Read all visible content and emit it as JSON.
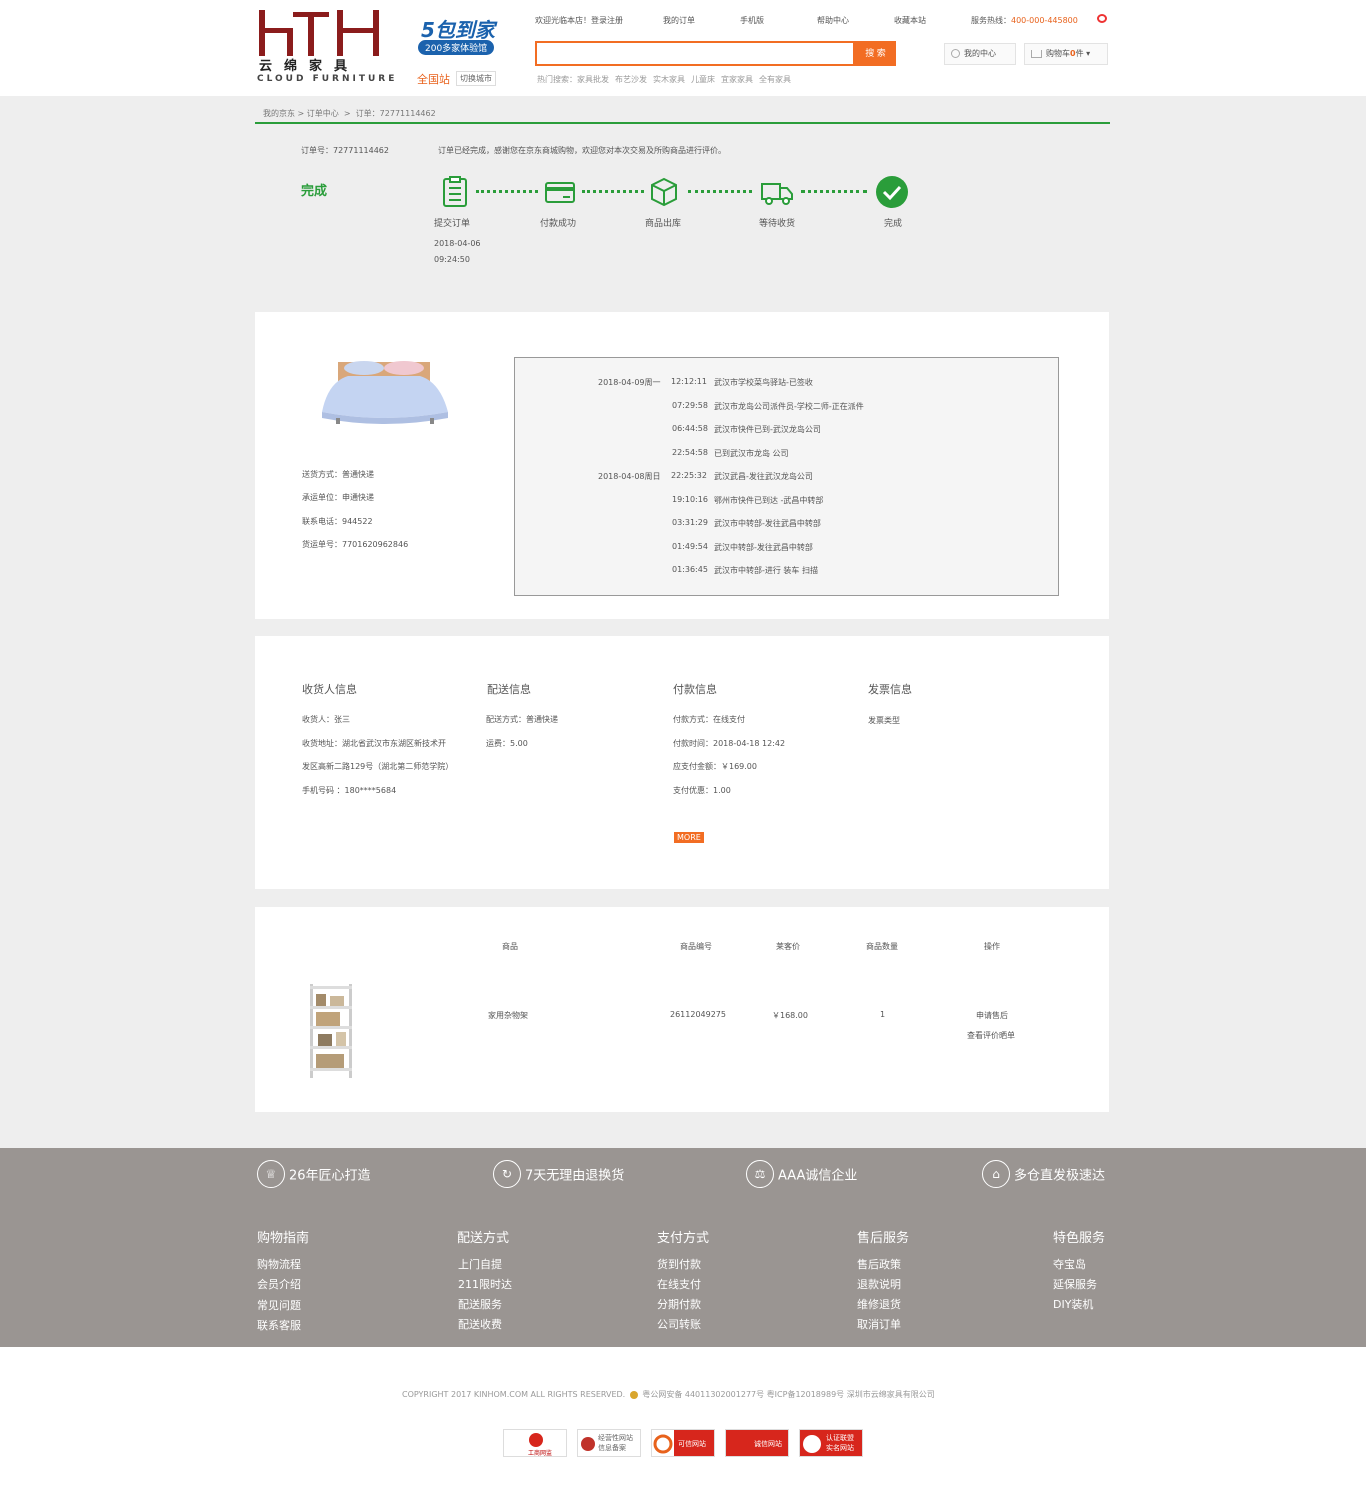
{
  "header": {
    "brand_cn": "云绵家具",
    "brand_en": "CLOUD FURNITURE",
    "promo_big": "5包到家",
    "promo_small": "200多家体验馆",
    "site_all": "全国站",
    "switch_city": "切换城市",
    "welcome": "欢迎光临本店！登录注册",
    "my_orders": "我的订单",
    "mobile": "手机版",
    "help": "帮助中心",
    "favorite": "收藏本站",
    "hotline_label": "服务热线：",
    "hotline": "400-000-445800",
    "search_button": "搜 索",
    "hot_search_label": "热门搜索：",
    "hot_search": [
      "家具批发",
      "布艺沙发",
      "实木家具",
      "儿童床",
      "宜家家具",
      "全有家具"
    ],
    "my_center": "我的中心",
    "cart_label": "购物车",
    "cart_count": "0",
    "cart_unit": "件"
  },
  "breadcrumb": {
    "home": "我的京东",
    "sep1": ">",
    "orders": "订单中心",
    "sep2": ">",
    "current": "订单：72771114462"
  },
  "order": {
    "number": "订单号：72771114462",
    "message": "订单已经完成，感谢您在京东商城购物，欢迎您对本次交易及所购商品进行评价。",
    "status": "完成",
    "steps": [
      {
        "label": "提交订单",
        "icon": "clipboard-icon"
      },
      {
        "label": "付款成功",
        "icon": "card-icon"
      },
      {
        "label": "商品出库",
        "icon": "box-icon"
      },
      {
        "label": "等待收货",
        "icon": "truck-icon"
      },
      {
        "label": "完成",
        "icon": "check-icon"
      }
    ],
    "submit_date": "2018-04-06",
    "submit_time": "09:24:50"
  },
  "shipping": {
    "method": "送货方式：普通快递",
    "carrier": "承运单位：申通快递",
    "phone": "联系电话：944522",
    "tracking_no": "货运单号：7701620962846"
  },
  "tracking": [
    {
      "date": "2018-04-09周一",
      "time": "12:12:11",
      "desc": "武汉市学校菜鸟驿站-已签收"
    },
    {
      "date": "",
      "time": "07:29:58",
      "desc": "武汉市龙岛公司派件员-学校二师-正在派件"
    },
    {
      "date": "",
      "time": "06:44:58",
      "desc": "武汉市快件已到-武汉龙岛公司"
    },
    {
      "date": "",
      "time": "22:54:58",
      "desc": "已到武汉市龙岛 公司"
    },
    {
      "date": "2018-04-08周日",
      "time": "22:25:32",
      "desc": "武汉武昌-发往武汉龙岛公司"
    },
    {
      "date": "",
      "time": "19:10:16",
      "desc": "鄂州市快件已到达 -武昌中转部"
    },
    {
      "date": "",
      "time": "03:31:29",
      "desc": "武汉市中转部-发往武昌中转部"
    },
    {
      "date": "",
      "time": "01:49:54",
      "desc": "武汉中转部-发往武昌中转部"
    },
    {
      "date": "",
      "time": "01:36:45",
      "desc": "武汉市中转部-进行 装车  扫描"
    }
  ],
  "info": {
    "receiver_title": "收货人信息",
    "receiver_name": "收货人：张三",
    "receiver_addr1": "收货地址：湖北省武汉市东湖区新技术开",
    "receiver_addr2": "发区高新二路129号（湖北第二师范学院）",
    "receiver_phone": "手机号码 ：180****5684",
    "delivery_title": "配送信息",
    "delivery_method": "配送方式：普通快递",
    "delivery_fee": "运费：5.00",
    "payment_title": "付款信息",
    "payment_method": "付款方式：在线支付",
    "payment_time": "付款时间：2018-04-18     12:42",
    "payment_due": "应支付金额：￥169.00",
    "payment_discount": "支付优惠：1.00",
    "more": "MORE",
    "invoice_title": "发票信息",
    "invoice_type": "发票类型"
  },
  "products": {
    "headers": [
      "商品",
      "商品编号",
      "莱客价",
      "商品数量",
      "操作"
    ],
    "rows": [
      {
        "name": "家用杂物架",
        "sku": "26112049275",
        "price": "￥168.00",
        "qty": "1",
        "action1": "申请售后",
        "action2": "查看评价晒单"
      }
    ]
  },
  "footer": {
    "features": [
      {
        "icon": "trophy-icon",
        "text": "26年匠心打造"
      },
      {
        "icon": "return-icon",
        "text": "7天无理由退换货"
      },
      {
        "icon": "scale-icon",
        "text": "AAA诚信企业"
      },
      {
        "icon": "warehouse-icon",
        "text": "多仓直发极速达"
      }
    ],
    "columns": [
      {
        "title": "购物指南",
        "links": [
          "购物流程",
          "会员介绍",
          "常见问题",
          "联系客服"
        ]
      },
      {
        "title": "配送方式",
        "links": [
          "上门自提",
          "211限时达",
          "配送服务",
          "配送收费"
        ]
      },
      {
        "title": "支付方式",
        "links": [
          "货到付款",
          "在线支付",
          "分期付款",
          "公司转账"
        ]
      },
      {
        "title": "售后服务",
        "links": [
          "售后政策",
          "退款说明",
          "维修退货",
          "取消订单"
        ]
      },
      {
        "title": "特色服务",
        "links": [
          "夺宝岛",
          "延保服务",
          "DIY装机"
        ]
      }
    ],
    "copyright": "COPYRIGHT 2017 KINHOM.COM ALL RIGHTS RESERVED.",
    "police": "粤公网安备 44011302001277号 粤ICP备12018989号 深圳市云绵家具有限公司",
    "badges": [
      "工商网监",
      "经营性网站 信息备案",
      "可信网站",
      "诚信网站",
      "认证联盟 实名网站"
    ]
  },
  "colors": {
    "accent": "#f26d23",
    "success": "#2a9d3a",
    "brand_red": "#8b1c1c",
    "footer_bg": "#9a9592"
  }
}
